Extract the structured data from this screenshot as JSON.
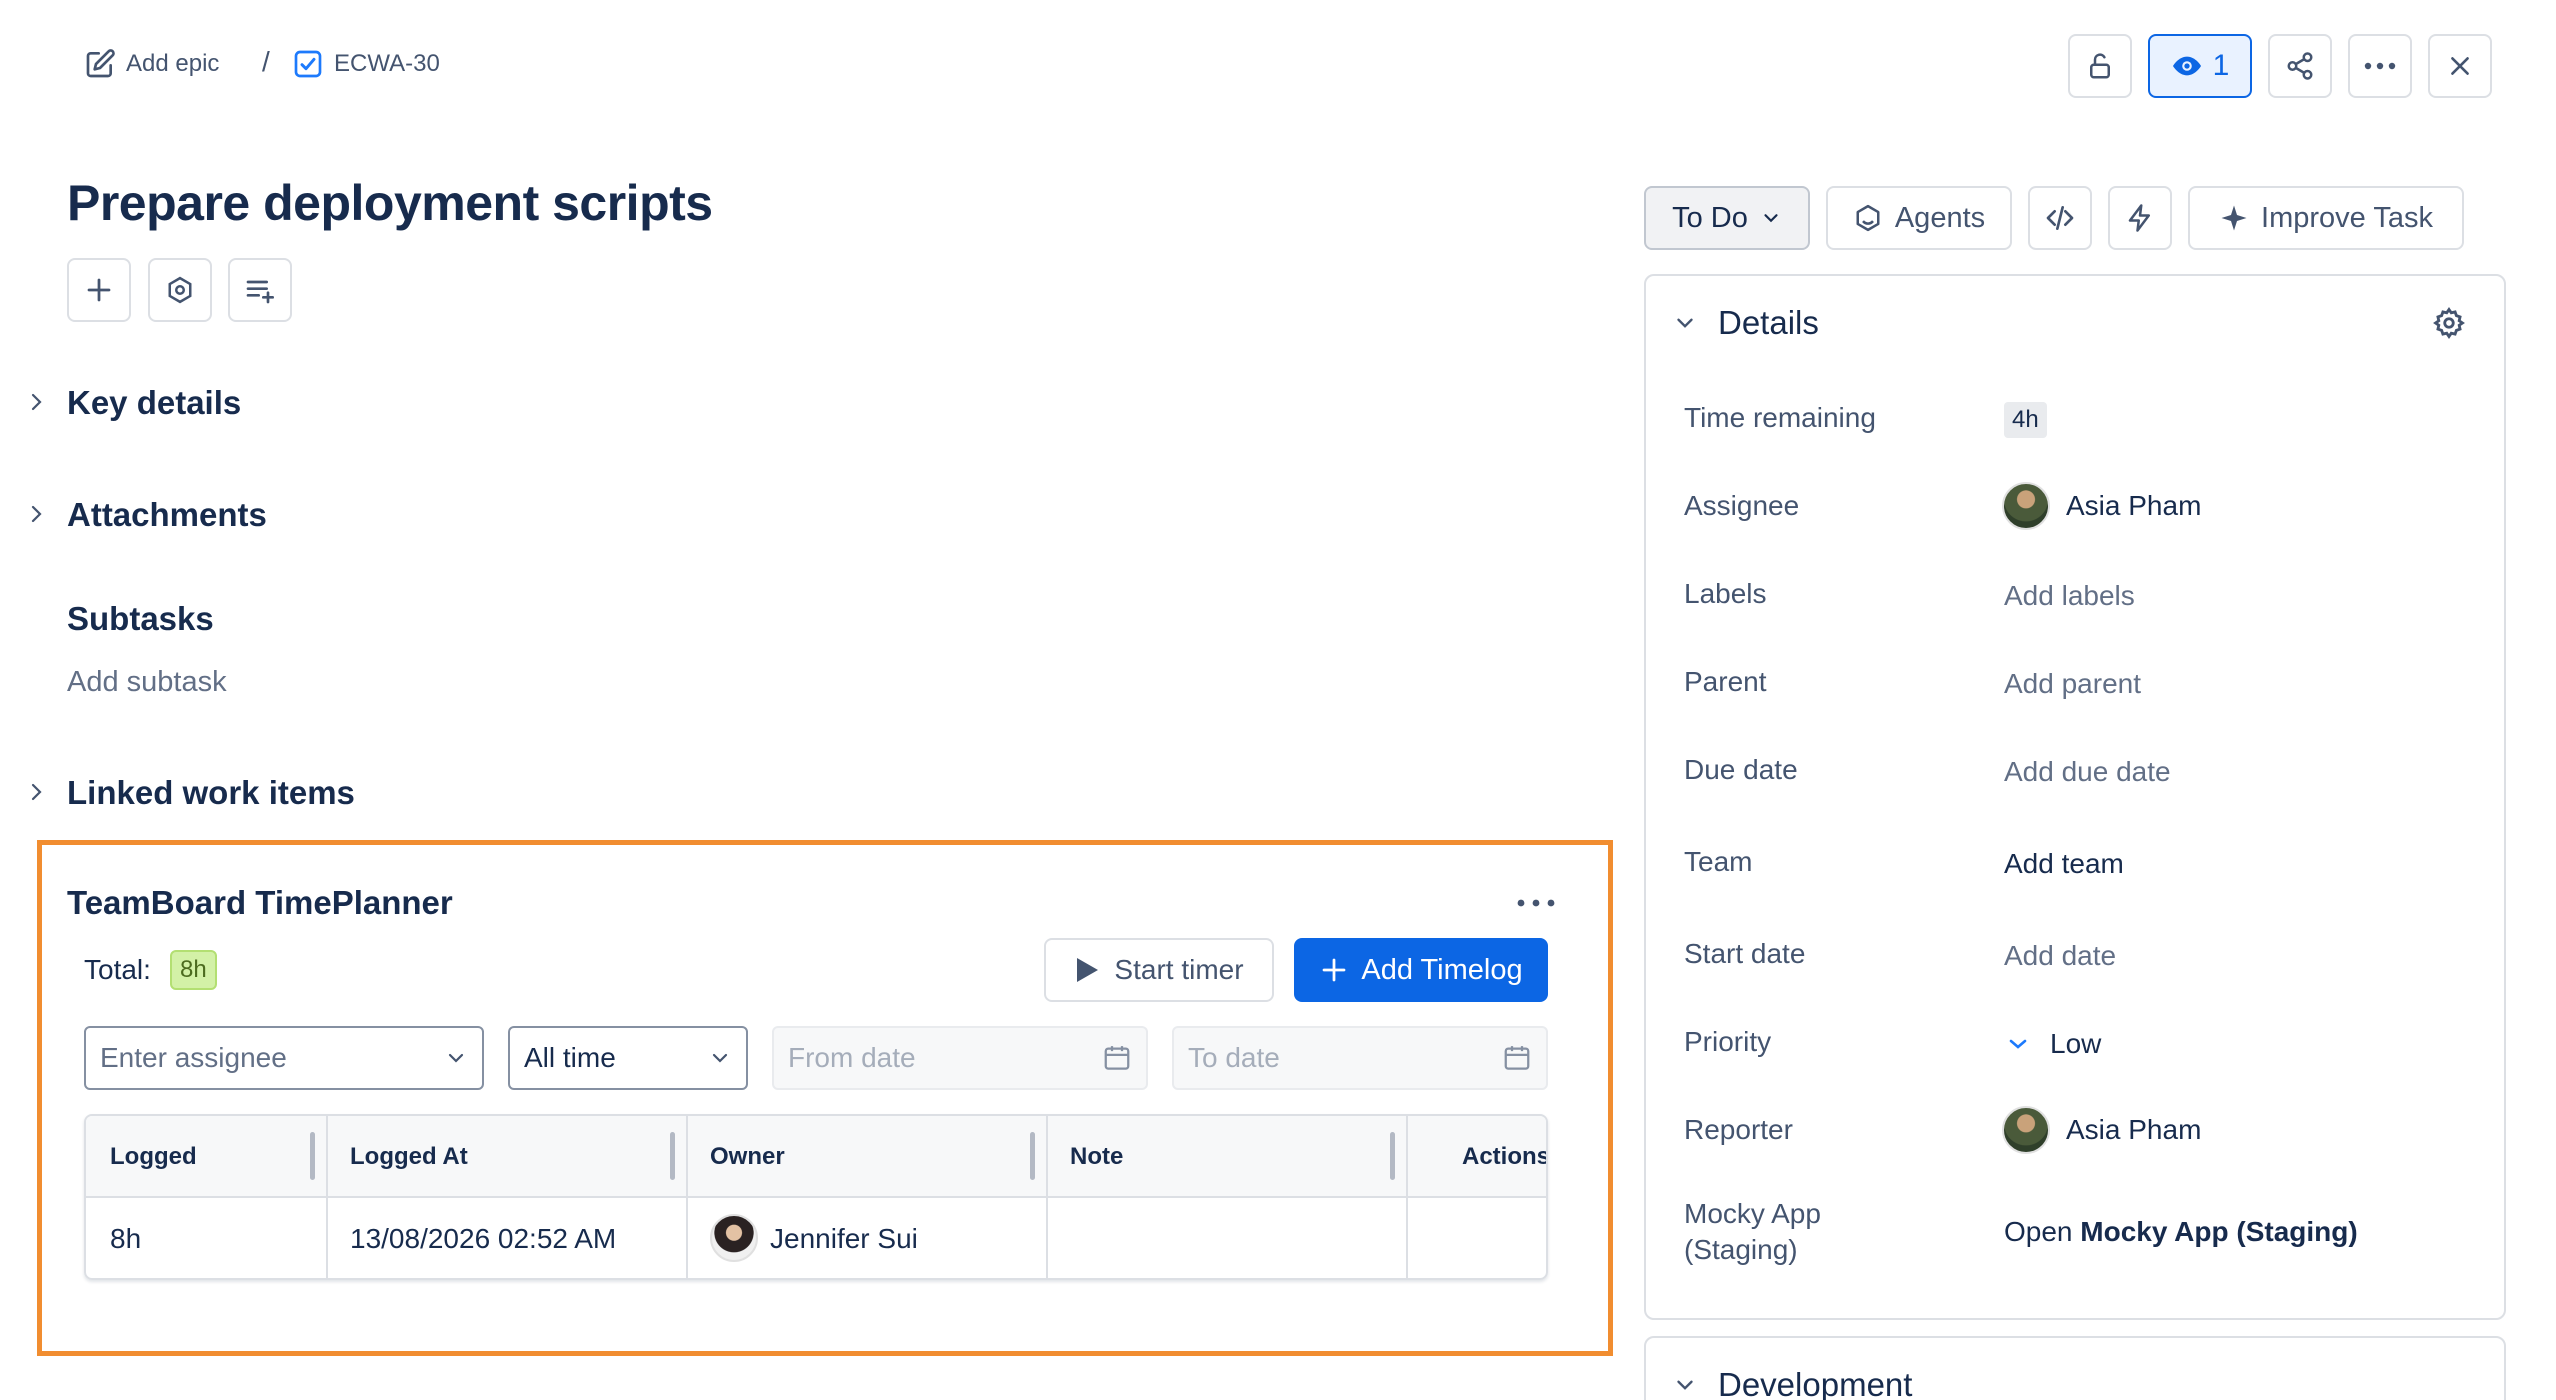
{
  "breadcrumb": {
    "epic_label": "Add epic",
    "separator": "/",
    "issue_key": "ECWA-30"
  },
  "header": {
    "watchers_count": "1"
  },
  "issue": {
    "title": "Prepare deployment scripts"
  },
  "sections": {
    "key_details": "Key details",
    "attachments": "Attachments",
    "subtasks": "Subtasks",
    "add_subtask": "Add subtask",
    "linked_work_items": "Linked work items"
  },
  "timeplanner": {
    "title": "TeamBoard TimePlanner",
    "total_label": "Total:",
    "total_value": "8h",
    "start_timer": "Start timer",
    "add_timelog": "Add Timelog",
    "filters": {
      "assignee_placeholder": "Enter assignee",
      "period": "All time",
      "from_placeholder": "From date",
      "to_placeholder": "To date"
    },
    "columns": [
      "Logged",
      "Logged At",
      "Owner",
      "Note",
      "Actions"
    ],
    "rows": [
      {
        "logged": "8h",
        "logged_at": "13/08/2026 02:52 AM",
        "owner": "Jennifer Sui",
        "note": "",
        "actions": ""
      }
    ]
  },
  "toolbar": {
    "status": "To Do",
    "agents": "Agents",
    "improve": "Improve Task"
  },
  "details": {
    "title": "Details",
    "fields": [
      {
        "label": "Time remaining",
        "value": "4h"
      },
      {
        "label": "Assignee",
        "value": "Asia Pham"
      },
      {
        "label": "Labels",
        "value": "Add labels"
      },
      {
        "label": "Parent",
        "value": "Add parent"
      },
      {
        "label": "Due date",
        "value": "Add due date"
      },
      {
        "label": "Team",
        "value": "Add team"
      },
      {
        "label": "Start date",
        "value": "Add date"
      },
      {
        "label": "Priority",
        "value": "Low"
      },
      {
        "label": "Reporter",
        "value": "Asia Pham"
      }
    ],
    "mocky": {
      "label_line1": "Mocky App",
      "label_line2": "(Staging)",
      "value_prefix": "Open",
      "value_bold": "Mocky App (Staging)"
    }
  },
  "development": {
    "title": "Development"
  },
  "colors": {
    "accent": "#0c66e4",
    "highlight_border": "#f18d30",
    "badge_green": "#d3f1a7"
  }
}
